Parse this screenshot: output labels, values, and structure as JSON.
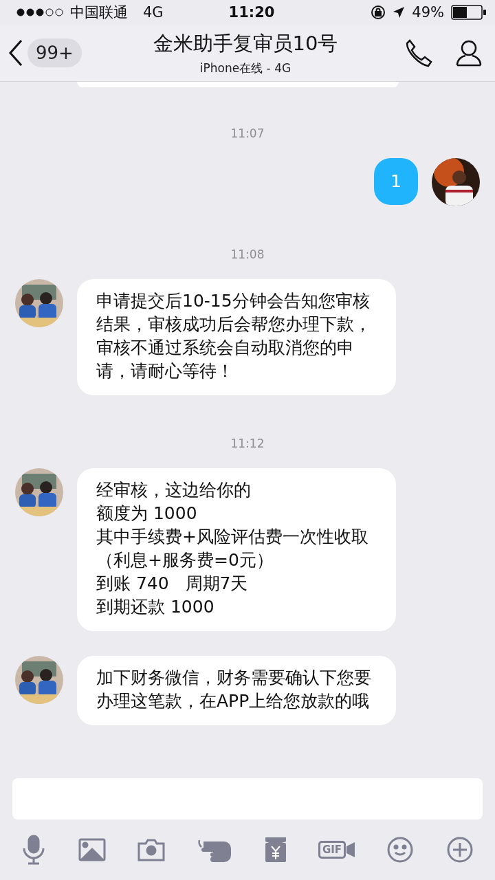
{
  "status_bar": {
    "carrier": "中国联通",
    "network": "4G",
    "time": "11:20",
    "battery": "49%"
  },
  "header": {
    "back_badge": "99+",
    "title": "金米助手复审员10号",
    "subtitle": "iPhone在线 - 4G"
  },
  "messages": [
    {
      "kind": "cut"
    },
    {
      "kind": "time",
      "text": "11:07"
    },
    {
      "kind": "sent",
      "text": "1"
    },
    {
      "kind": "time",
      "text": "11:08"
    },
    {
      "kind": "received",
      "text": "申请提交后10-15分钟会告知您审核结果，审核成功后会帮您办理下款，审核不通过系统会自动取消您的申请，请耐心等待！"
    },
    {
      "kind": "time",
      "text": "11:12"
    },
    {
      "kind": "received",
      "lines": [
        "经审核，这边给你的",
        "额度为 1000",
        "其中手续费+风险评估费一次性收取（利息+服务费=0元）",
        "到账 740   周期7天",
        "到期还款 1000"
      ]
    },
    {
      "kind": "received",
      "text": "加下财务微信，财务需要确认下您要办理这笔款，在APP上给您放款的哦"
    }
  ],
  "toolbar": {
    "gif_label": "GIF"
  }
}
